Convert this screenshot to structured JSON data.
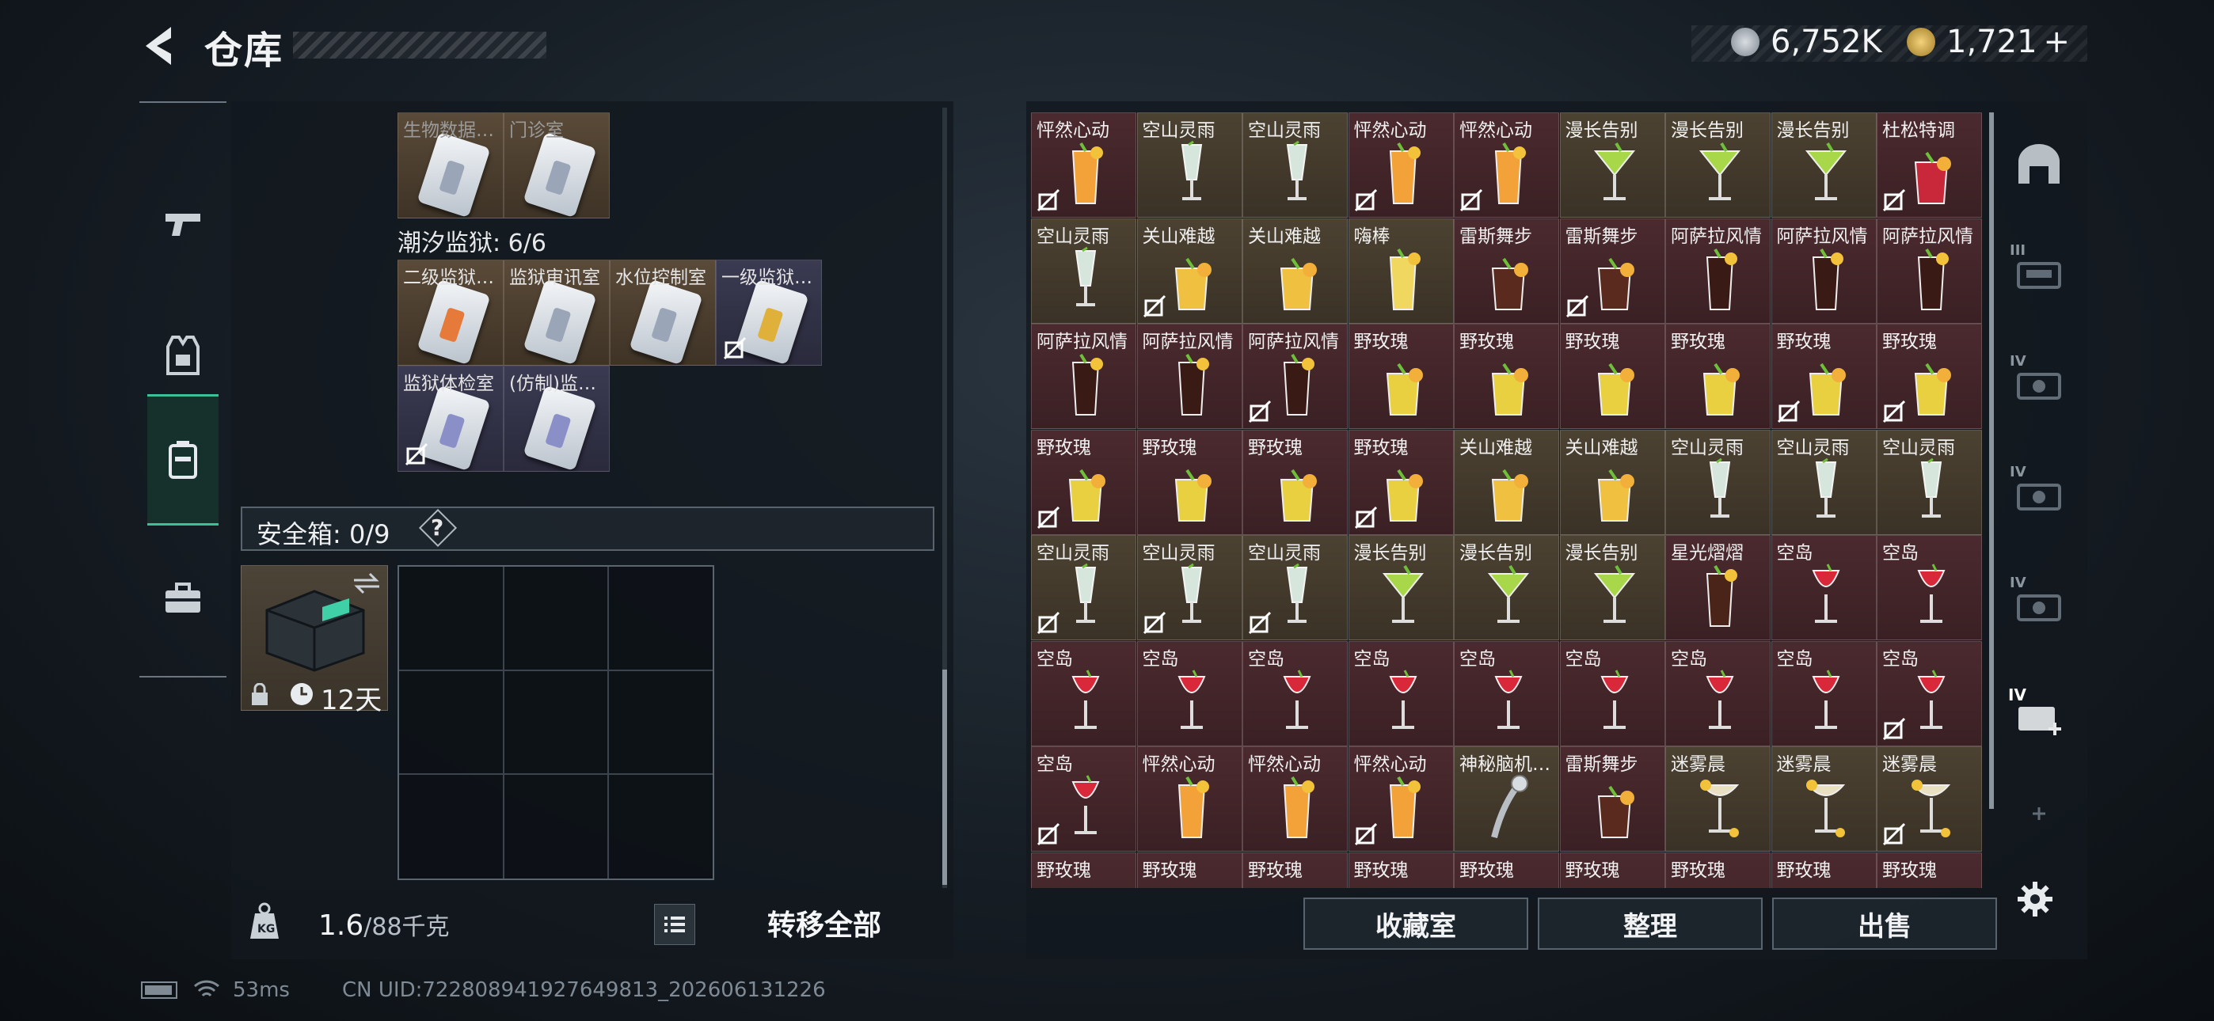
{
  "header": {
    "title": "仓库",
    "currency_a": "6,752K",
    "currency_b": "1,721",
    "plus": "+"
  },
  "left": {
    "top_items": [
      {
        "name": "生物数据…",
        "bg": "brown"
      },
      {
        "name": "门诊室",
        "bg": "brown"
      }
    ],
    "prison_label": "潮汐监狱: 6/6",
    "prison_items": [
      {
        "name": "二级监狱…",
        "strip": "#e67a3a",
        "bg": "brown",
        "lock": false
      },
      {
        "name": "监狱审讯室",
        "strip": "#9aa6b8",
        "bg": "brown",
        "lock": false
      },
      {
        "name": "水位控制室",
        "strip": "#9aa6b8",
        "bg": "brown",
        "lock": false
      },
      {
        "name": "一级监狱…",
        "strip": "#e0b13a",
        "bg": "purple",
        "lock": true
      },
      {
        "name": "监狱体检室",
        "strip": "#8a8fc8",
        "bg": "purple",
        "lock": true
      },
      {
        "name": "(仿制)监…",
        "strip": "#8a8fc8",
        "bg": "purple",
        "lock": false
      }
    ],
    "safebox_label": "安全箱: 0/9",
    "help": "?",
    "case_days": "12天",
    "weight_value": "1.6",
    "weight_max": "/88千克",
    "transfer_all": "转移全部"
  },
  "right": {
    "items": [
      [
        "怦然心动",
        "空山灵雨",
        "空山灵雨",
        "怦然心动",
        "怦然心动",
        "漫长告别",
        "漫长告别",
        "漫长告别",
        "杜松特调"
      ],
      [
        "空山灵雨",
        "关山难越",
        "关山难越",
        "嗨棒",
        "雷斯舞步",
        "雷斯舞步",
        "阿萨拉风情",
        "阿萨拉风情",
        "阿萨拉风情"
      ],
      [
        "阿萨拉风情",
        "阿萨拉风情",
        "阿萨拉风情",
        "野玫瑰",
        "野玫瑰",
        "野玫瑰",
        "野玫瑰",
        "野玫瑰",
        "野玫瑰"
      ],
      [
        "野玫瑰",
        "野玫瑰",
        "野玫瑰",
        "野玫瑰",
        "关山难越",
        "关山难越",
        "空山灵雨",
        "空山灵雨",
        "空山灵雨"
      ],
      [
        "空山灵雨",
        "空山灵雨",
        "空山灵雨",
        "漫长告别",
        "漫长告别",
        "漫长告别",
        "星光熠熠",
        "空岛",
        "空岛"
      ],
      [
        "空岛",
        "空岛",
        "空岛",
        "空岛",
        "空岛",
        "空岛",
        "空岛",
        "空岛",
        "空岛"
      ],
      [
        "空岛",
        "怦然心动",
        "怦然心动",
        "怦然心动",
        "神秘脑机…",
        "雷斯舞步",
        "迷雾晨",
        "迷雾晨",
        "迷雾晨"
      ],
      [
        "野玫瑰",
        "野玫瑰",
        "野玫瑰",
        "野玫瑰",
        "野玫瑰",
        "野玫瑰",
        "野玫瑰",
        "野玫瑰",
        "野玫瑰"
      ]
    ],
    "buttons": {
      "collection": "收藏室",
      "sort": "整理",
      "sell": "出售"
    },
    "nav_labels": [
      "III",
      "IV",
      "IV",
      "IV",
      "IV"
    ]
  },
  "status_bar": {
    "ping": "53ms",
    "uid": "CN UID:722808941927649813_202606131226"
  },
  "colors": {
    "accent": "#3fbf95",
    "red_cell": "#4b2a2f",
    "gold_cell": "#4c4232"
  }
}
